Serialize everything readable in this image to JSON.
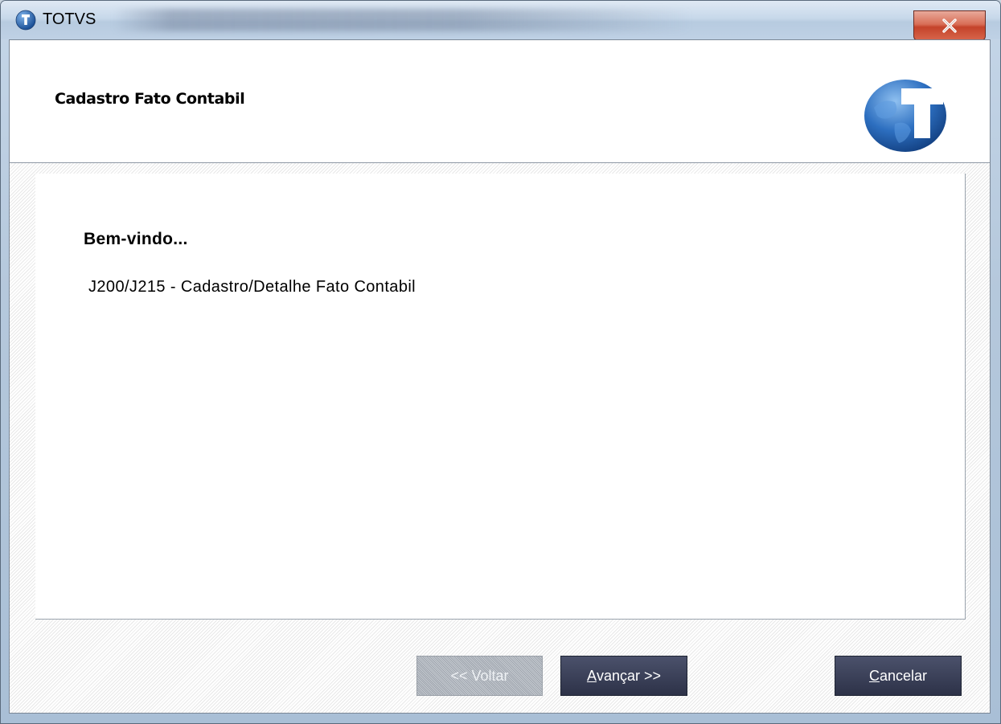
{
  "window": {
    "title": "TOTVS"
  },
  "header": {
    "title": "Cadastro Fato Contabil"
  },
  "content": {
    "welcome": "Bem-vindo...",
    "description": "J200/J215 - Cadastro/Detalhe Fato Contabil"
  },
  "buttons": {
    "back_mnemonic": "<",
    "back_rest": "< Voltar",
    "next_mnemonic": "A",
    "next_rest": "vançar >>",
    "cancel_mnemonic": "C",
    "cancel_rest": "ancelar"
  },
  "colors": {
    "button_dark": "#2d3248",
    "close_red": "#c4432a",
    "logo_blue": "#1f5fae"
  },
  "icons": {
    "app": "totvs-logo-icon",
    "close": "close-icon",
    "logo": "totvs-globe-logo"
  }
}
